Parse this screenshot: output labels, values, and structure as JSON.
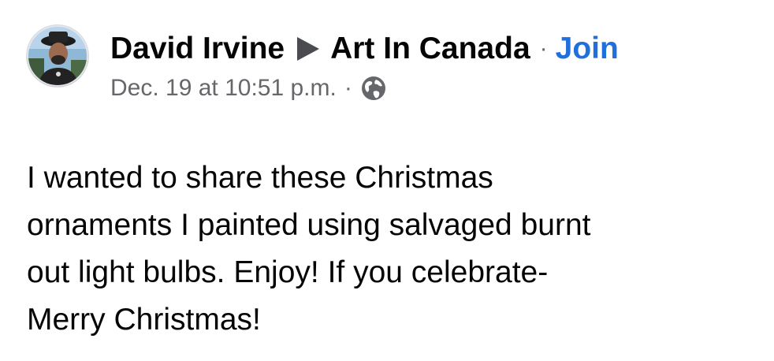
{
  "post": {
    "author": "David Irvine",
    "group": "Art In Canada",
    "separator": "·",
    "join_label": "Join",
    "timestamp": "Dec. 19 at 10:51 p.m.",
    "meta_separator": "·",
    "audience_icon": "globe-icon",
    "avatar_icon": "profile-photo",
    "arrow_icon": "right-triangle-icon",
    "body_lines": [
      "I wanted to share these Christmas",
      "ornaments I painted using salvaged burnt",
      "out light bulbs. Enjoy! If you celebrate-",
      "Merry Christmas!"
    ]
  },
  "colors": {
    "primary_text": "#050505",
    "secondary_text": "#65676b",
    "link_blue": "#216fdb"
  }
}
